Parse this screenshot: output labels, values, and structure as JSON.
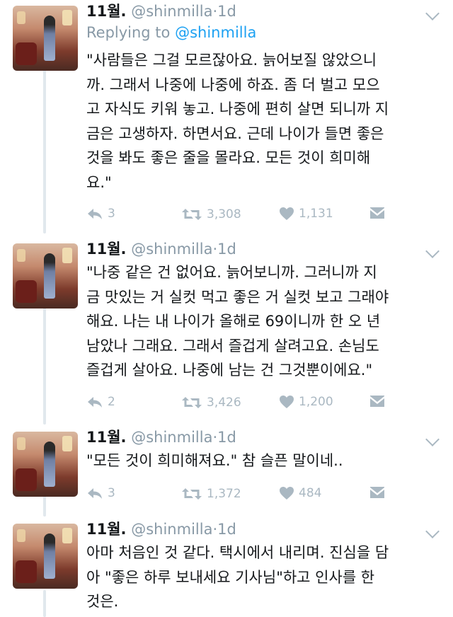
{
  "tweets": [
    {
      "name": "11월.",
      "handle": "@shinmilla",
      "sep": "·",
      "time": "1d",
      "reply_prefix": "Replying to",
      "reply_handle": "@shinmilla",
      "text": "\"사람들은 그걸 모르잖아요. 늙어보질 않았으니\n까. 그래서 나중에 나중에 하죠. 좀 더 벌고 모으\n고 자식도 키워 놓고. 나중에 편히 살면 되니까 지\n금은 고생하자. 하면서요. 근데 나이가 들면 좋은\n것을 봐도 좋은 줄을 몰라요. 모든 것이 희미해\n요.\"",
      "replies": "3",
      "retweets": "3,308",
      "likes": "1,131"
    },
    {
      "name": "11월.",
      "handle": "@shinmilla",
      "sep": "·",
      "time": "1d",
      "text": "\"나중 같은 건 없어요. 늙어보니까. 그러니까 지\n금 맛있는 거 실컷 먹고 좋은 거 실컷 보고 그래야\n해요. 나는 내 나이가 올해로 69이니까 한 오 년\n남았나 그래요. 그래서 즐겁게 살려고요. 손님도\n즐겁게 살아요. 나중에 남는 건 그것뿐이에요.\"",
      "replies": "2",
      "retweets": "3,426",
      "likes": "1,200"
    },
    {
      "name": "11월.",
      "handle": "@shinmilla",
      "sep": "·",
      "time": "1d",
      "text": "\"모든 것이 희미해져요.\" 참 슬픈 말이네..",
      "replies": "3",
      "retweets": "1,372",
      "likes": "484"
    },
    {
      "name": "11월.",
      "handle": "@shinmilla",
      "sep": "·",
      "time": "1d",
      "text": "아마 처음인 것 같다. 택시에서 내리며. 진심을 담\n아 \"좋은 하루 보내세요 기사님\"하고 인사를 한\n것은."
    }
  ],
  "icons": [
    "reply-icon",
    "retweet-icon",
    "like-icon",
    "direct-message-icon",
    "chevron-down-icon"
  ],
  "colors": {
    "link": "#1da1f2",
    "muted": "#8899a6",
    "icon": "#aab8c2",
    "thread_line": "#e1e8ed"
  }
}
